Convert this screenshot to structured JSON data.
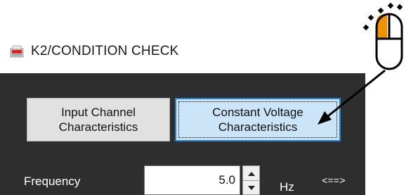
{
  "window": {
    "title": "K2/CONDITION CHECK",
    "icon": "app-logo-icon"
  },
  "buttons": {
    "input_channel": "Input Channel\nCharacteristics",
    "input_channel_line1": "Input Channel",
    "input_channel_line2": "Characteristics",
    "constant_voltage_line1": "Constant Voltage",
    "constant_voltage_line2": "Characteristics"
  },
  "frequency": {
    "label": "Frequency",
    "value": "5.0",
    "unit": "Hz",
    "swap_link": "<==>"
  },
  "annotation": {
    "icon": "mouse-click-icon",
    "accent": "#f29100"
  }
}
